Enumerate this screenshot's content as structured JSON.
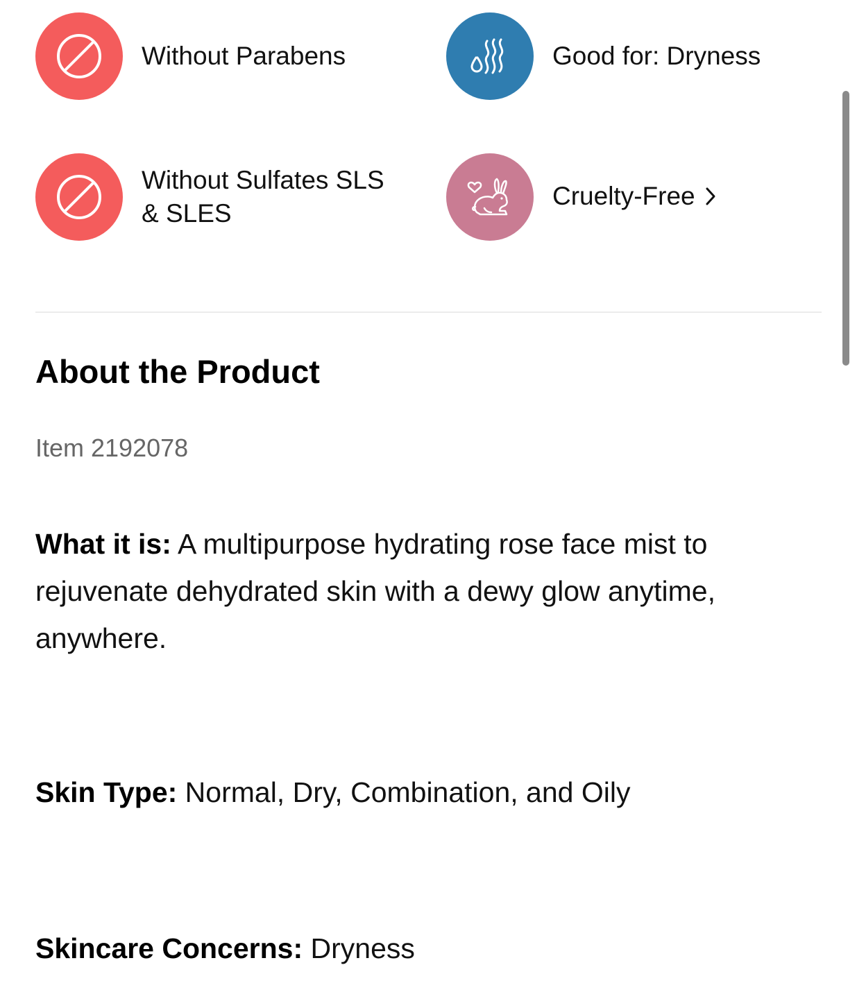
{
  "badges": [
    {
      "label": "Without Parabens",
      "icon": "prohibited-icon",
      "color": "#f45c5c"
    },
    {
      "label": "Good for: Dryness",
      "icon": "water-drops-icon",
      "color": "#2f7db0"
    },
    {
      "label_line1": "Without Sulfates SLS",
      "label_line2": "& SLES",
      "icon": "prohibited-icon",
      "color": "#f45c5c"
    },
    {
      "label": "Cruelty-Free",
      "icon": "rabbit-heart-icon",
      "color": "#c97c93",
      "link_chevron": "chevron-right-icon"
    }
  ],
  "about": {
    "title": "About the Product",
    "item_number": "Item 2192078",
    "what_it_is": {
      "label": "What it is:",
      "text": " A multipurpose hydrating rose face mist to rejuvenate dehydrated skin with a dewy glow anytime, anywhere."
    },
    "skin_type": {
      "label": "Skin Type:",
      "text": " Normal, Dry, Combination, and Oily"
    },
    "skincare_concerns": {
      "label": "Skincare Concerns:",
      "text": " Dryness"
    }
  }
}
